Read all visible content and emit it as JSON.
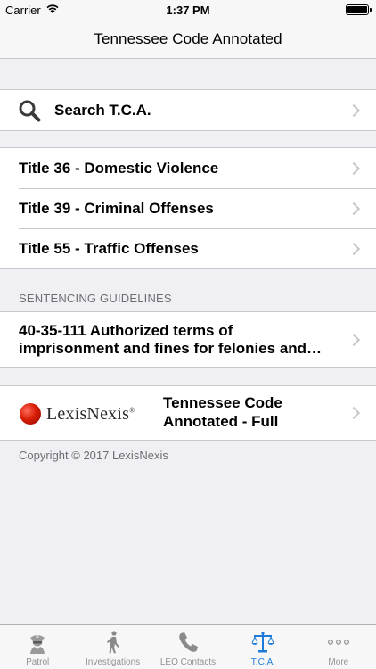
{
  "status": {
    "carrier": "Carrier",
    "time": "1:37 PM"
  },
  "navbar": {
    "title": "Tennessee Code Annotated"
  },
  "search": {
    "label": "Search T.C.A."
  },
  "titles": [
    {
      "label": "Title 36 - Domestic Violence"
    },
    {
      "label": "Title 39 - Criminal Offenses"
    },
    {
      "label": "Title 55 - Traffic Offenses"
    }
  ],
  "sentencing": {
    "header": "SENTENCING GUIDELINES",
    "item_line1": "40-35-111 Authorized terms of",
    "item_line2": "imprisonment and fines for felonies and…"
  },
  "lexis": {
    "brand": "LexisNexis",
    "reg": "®",
    "title_line1": "Tennessee Code",
    "title_line2": "Annotated - Full"
  },
  "copyright": "Copyright © 2017 LexisNexis",
  "tabs": [
    {
      "label": "Patrol",
      "icon": "police-officer-icon"
    },
    {
      "label": "Investigations",
      "icon": "walking-person-icon"
    },
    {
      "label": "LEO Contacts",
      "icon": "phone-icon"
    },
    {
      "label": "T.C.A.",
      "icon": "scales-of-justice-icon",
      "active": true
    },
    {
      "label": "More",
      "icon": "more-dots-icon"
    }
  ],
  "colors": {
    "accent": "#1e7bd9",
    "inactive": "#929292",
    "background": "#efeff4"
  }
}
